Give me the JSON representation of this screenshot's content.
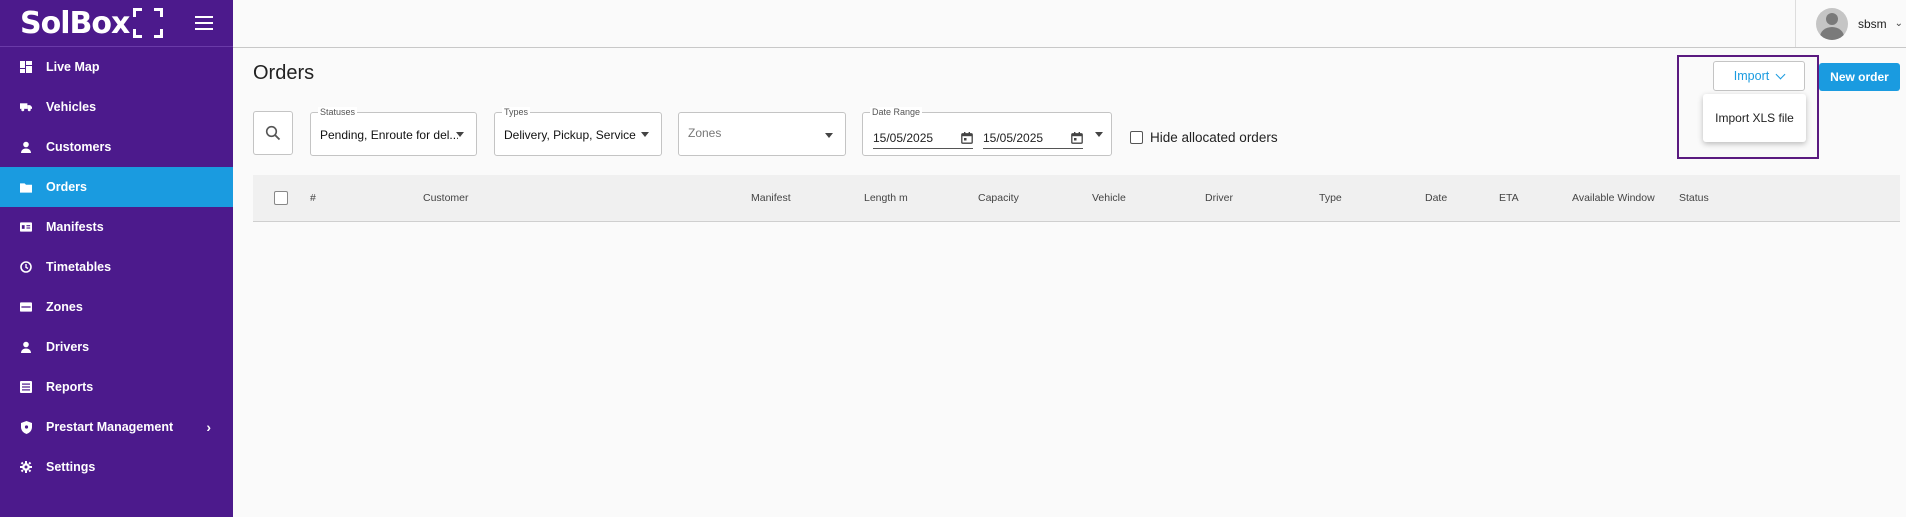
{
  "sidebar": {
    "logo_text": "SolBox",
    "items": [
      {
        "label": "Live Map",
        "icon": "dashboard-icon"
      },
      {
        "label": "Vehicles",
        "icon": "truck-icon"
      },
      {
        "label": "Customers",
        "icon": "person-icon"
      },
      {
        "label": "Orders",
        "icon": "folder-icon",
        "active": true
      },
      {
        "label": "Manifests",
        "icon": "id-card-icon"
      },
      {
        "label": "Timetables",
        "icon": "clock-icon"
      },
      {
        "label": "Zones",
        "icon": "zones-icon"
      },
      {
        "label": "Drivers",
        "icon": "person-icon"
      },
      {
        "label": "Reports",
        "icon": "report-icon"
      },
      {
        "label": "Prestart Management",
        "icon": "shield-icon",
        "has_children": true
      },
      {
        "label": "Settings",
        "icon": "gear-icon"
      }
    ]
  },
  "topbar": {
    "username": "sbsm"
  },
  "page": {
    "title": "Orders"
  },
  "filters": {
    "statuses": {
      "legend": "Statuses",
      "value": "Pending, Enroute for del..."
    },
    "types": {
      "legend": "Types",
      "value": "Delivery, Pickup, Service"
    },
    "zones": {
      "placeholder": "Zones"
    },
    "date_range": {
      "legend": "Date Range",
      "from": "15/05/2025",
      "to": "15/05/2025"
    },
    "hide_allocated_label": "Hide allocated orders"
  },
  "actions": {
    "import_label": "Import",
    "import_menu_item": "Import XLS file",
    "new_order_label": "New order"
  },
  "table": {
    "columns": [
      "#",
      "Customer",
      "Manifest",
      "Length m",
      "Capacity",
      "Vehicle",
      "Driver",
      "Type",
      "Date",
      "ETA",
      "Available Window",
      "Status"
    ]
  },
  "colors": {
    "sidebar_bg": "#4c1a8c",
    "accent": "#1a9be0",
    "highlight_border": "#5a1a80"
  }
}
